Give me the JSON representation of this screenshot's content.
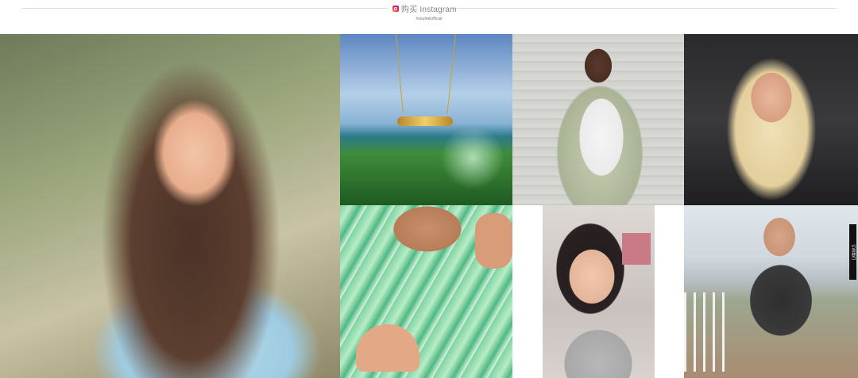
{
  "header": {
    "title": "购买 Instagram",
    "handle": "#soufeelofficial",
    "icon": "instagram-icon"
  },
  "gallery": {
    "tiles": [
      {
        "name": "photo-selfie-necklace"
      },
      {
        "name": "photo-wanderlust-necklace"
      },
      {
        "name": "photo-blazer-outfit"
      },
      {
        "name": "photo-car-selfie"
      },
      {
        "name": "photo-green-dress"
      },
      {
        "name": "photo-portrait-closeup"
      },
      {
        "name": "photo-beach-outfit"
      }
    ]
  },
  "side_tab": {
    "label": "订阅我们"
  }
}
